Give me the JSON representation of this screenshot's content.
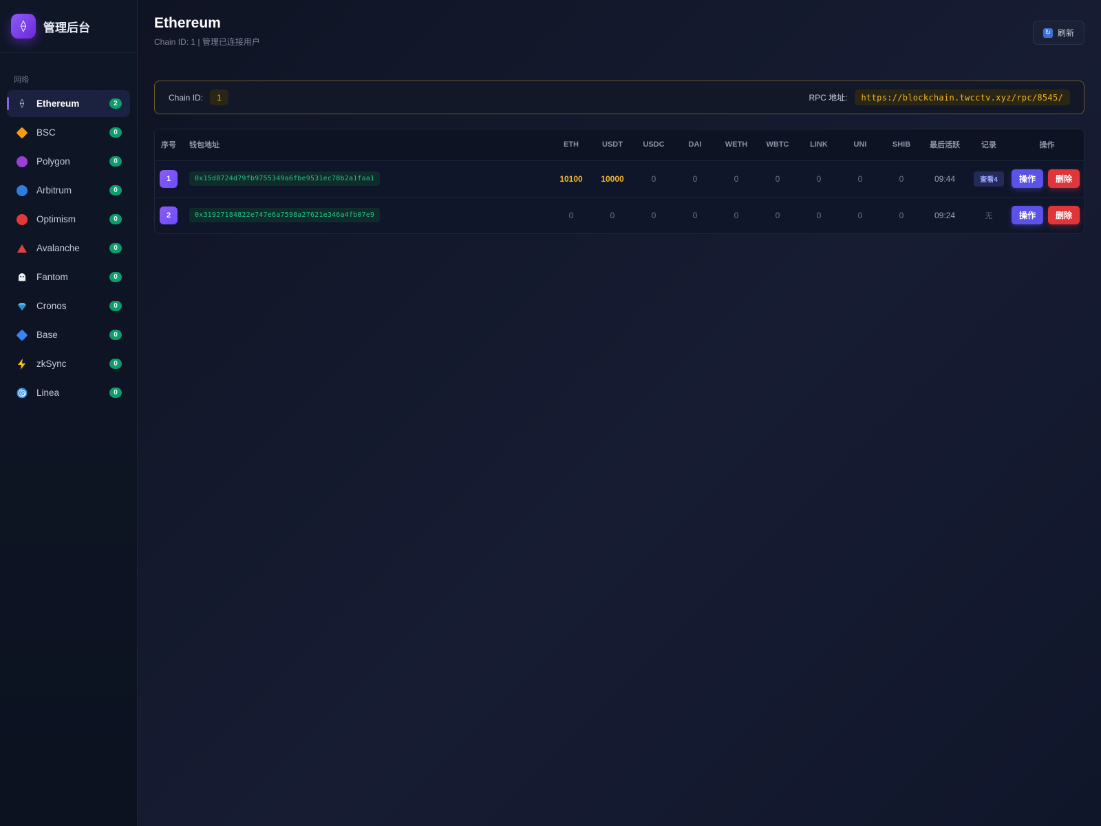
{
  "brand": {
    "title": "管理后台",
    "logo_icon": "eth-diamond-icon",
    "logo_glyph": "⟠"
  },
  "sidebar": {
    "section_label": "网络",
    "items": [
      {
        "label": "Ethereum",
        "count": "2",
        "icon": "ethereum-icon",
        "active": true
      },
      {
        "label": "BSC",
        "count": "0",
        "icon": "bsc-icon"
      },
      {
        "label": "Polygon",
        "count": "0",
        "icon": "polygon-icon"
      },
      {
        "label": "Arbitrum",
        "count": "0",
        "icon": "arbitrum-icon"
      },
      {
        "label": "Optimism",
        "count": "0",
        "icon": "optimism-icon"
      },
      {
        "label": "Avalanche",
        "count": "0",
        "icon": "avalanche-icon"
      },
      {
        "label": "Fantom",
        "count": "0",
        "icon": "fantom-icon"
      },
      {
        "label": "Cronos",
        "count": "0",
        "icon": "cronos-icon"
      },
      {
        "label": "Base",
        "count": "0",
        "icon": "base-icon"
      },
      {
        "label": "zkSync",
        "count": "0",
        "icon": "zksync-icon"
      },
      {
        "label": "Linea",
        "count": "0",
        "icon": "linea-icon"
      }
    ]
  },
  "header": {
    "title": "Ethereum",
    "subtitle": "Chain ID: 1 | 管理已连接用户",
    "refresh_label": "刷新"
  },
  "info": {
    "chain_label": "Chain ID:",
    "chain_value": "1",
    "rpc_label": "RPC 地址:",
    "rpc_value": "https://blockchain.twcctv.xyz/rpc/8545/"
  },
  "table": {
    "columns": [
      "序号",
      "钱包地址",
      "ETH",
      "USDT",
      "USDC",
      "DAI",
      "WETH",
      "WBTC",
      "LINK",
      "UNI",
      "SHIB",
      "最后活跃",
      "记录",
      "操作"
    ],
    "rows": [
      {
        "index": "1",
        "address": "0x15d8724d79fb9755349a6fbe9531ec78b2a1faa1",
        "eth": "10100",
        "usdt": "10000",
        "usdc": "0",
        "dai": "0",
        "weth": "0",
        "wbtc": "0",
        "link": "0",
        "uni": "0",
        "shib": "0",
        "last_active": "09:44",
        "record": "查看4",
        "op_label": "操作",
        "del_label": "删除"
      },
      {
        "index": "2",
        "address": "0x31927184822e747e6a7598a27621e346a4fb07e9",
        "eth": "0",
        "usdt": "0",
        "usdc": "0",
        "dai": "0",
        "weth": "0",
        "wbtc": "0",
        "link": "0",
        "uni": "0",
        "shib": "0",
        "last_active": "09:24",
        "record": "无",
        "op_label": "操作",
        "del_label": "删除"
      }
    ]
  },
  "colors": {
    "accent": "#8b5cf6",
    "badge_green": "#0f9b6c",
    "highlight_amber": "#f5b52a",
    "danger": "#e0353a",
    "primary_button": "#5b52e8"
  }
}
